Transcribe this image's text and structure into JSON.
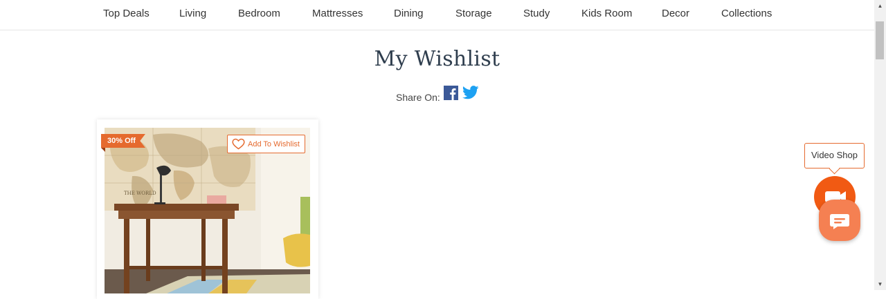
{
  "nav": {
    "items": [
      "Top Deals",
      "Living",
      "Bedroom",
      "Mattresses",
      "Dining",
      "Storage",
      "Study",
      "Kids Room",
      "Decor",
      "Collections"
    ]
  },
  "page": {
    "title": "My Wishlist",
    "share_label": "Share On:"
  },
  "product_card": {
    "discount_badge": "30% Off",
    "wishlist_button": "Add To Wishlist",
    "map_text": "THE WORLD"
  },
  "widgets": {
    "video_shop_label": "Video Shop"
  },
  "colors": {
    "accent": "#e56a2e",
    "video_button": "#f15a13",
    "chat_button": "#f58052",
    "facebook": "#3b5998",
    "twitter": "#1da1f2",
    "title": "#2f3e4e"
  },
  "icons": [
    "facebook-icon",
    "twitter-icon",
    "heart-icon",
    "video-camera-icon",
    "chat-icon"
  ]
}
